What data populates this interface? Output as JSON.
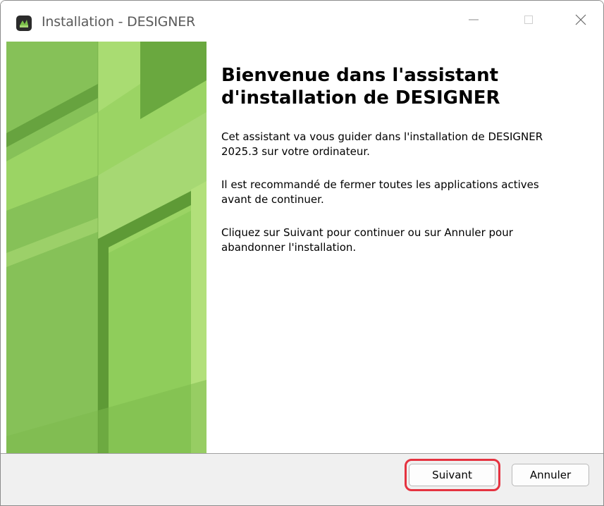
{
  "window": {
    "title": "Installation - DESIGNER",
    "controls": {
      "minimize_icon": "minimize-icon",
      "maximize_icon": "maximize-icon",
      "close_icon": "close-icon"
    }
  },
  "banner": {
    "colors": [
      "#9bd464",
      "#86c158",
      "#6aa83f",
      "#4f8a2b",
      "#b2e07a"
    ]
  },
  "content": {
    "heading_line1": "Bienvenue dans l'assistant",
    "heading_line2": "d'installation de DESIGNER",
    "paragraph1_line1": "Cet assistant va vous guider dans l'installation de DESIGNER",
    "paragraph1_line2": "2025.3 sur votre ordinateur.",
    "paragraph2_line1": "Il est recommandé de fermer toutes les applications actives",
    "paragraph2_line2": "avant de continuer.",
    "paragraph3_line1": "Cliquez sur Suivant pour continuer ou sur Annuler pour",
    "paragraph3_line2": "abandonner l'installation."
  },
  "footer": {
    "next_label": "Suivant",
    "cancel_label": "Annuler",
    "highlight_color": "#e53340"
  }
}
